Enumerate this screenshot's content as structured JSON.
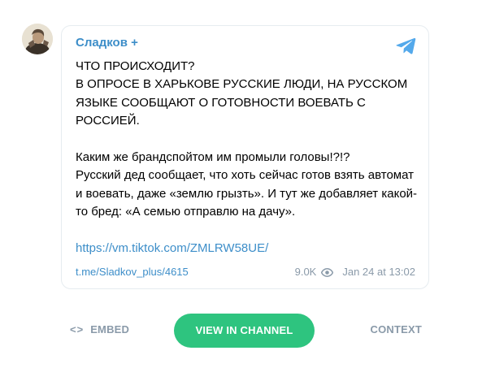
{
  "channel": {
    "name": "Сладков +",
    "avatar_icon": "channel-avatar-photo"
  },
  "message": {
    "text": "ЧТО ПРОИСХОДИТ?\nВ ОПРОСЕ В ХАРЬКОВЕ РУССКИЕ ЛЮДИ, НА РУССКОМ ЯЗЫКЕ СООБЩАЮТ О ГОТОВНОСТИ ВОЕВАТЬ С РОССИЕЙ.\n\nКаким же брандспойтом им промыли головы!?!?\nРусский дед сообщает, что хоть сейчас готов взять автомат и воевать, даже «землю грызть». И тут же добавляет какой-то бред: «А семью отправлю на дачу».\n\n",
    "link": "https://vm.tiktok.com/ZMLRW58UE/"
  },
  "footer": {
    "post_link": "t.me/Sladkov_plus/4615",
    "views": "9.0K",
    "views_icon": "eye-icon",
    "date": "Jan 24 at 13:02"
  },
  "actions": {
    "embed_icon": "<>",
    "embed_label": "EMBED",
    "view_label": "VIEW IN CHANNEL",
    "context_label": "CONTEXT"
  },
  "colors": {
    "accent": "#3d8ec9",
    "button_green": "#2ec47f",
    "muted": "#8a9aa9",
    "border": "#e6ecf0"
  }
}
